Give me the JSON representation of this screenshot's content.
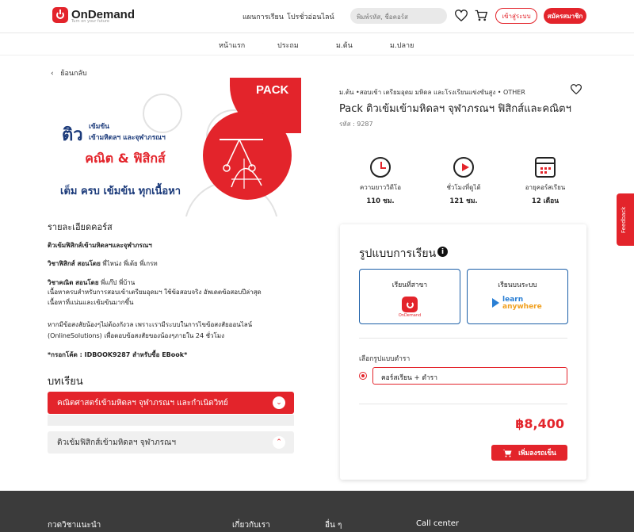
{
  "header": {
    "logo_text": "OnDemand",
    "logo_tagline": "Turn on your future",
    "nav_plan": "แผนการเรียน",
    "nav_promo": "โปรชั่วอ่อนไลน์",
    "search_placeholder": "พิมพ์รหัส, ชื่อคอร์ส",
    "login_label": "เข้าสู่ระบบ",
    "register_label": "สมัครสมาชิก"
  },
  "subnav": {
    "home": "หน้าแรก",
    "primary": "ประถม",
    "lower_secondary": "ม.ต้น",
    "upper_secondary": "ม.ปลาย"
  },
  "back_label": "ย้อนกลับ",
  "pack_image": {
    "label": "PACK",
    "t1": "ติว",
    "t2": "เข้มข้น",
    "t3": "เข้ามหิดลฯ และจุฬาภรณฯ",
    "banner": "คณิต & ฟิสิกส์",
    "t4": "เต็ม ครบ เข้มข้น ทุกเนื้อหา"
  },
  "details": {
    "title": "รายละเอียดคอร์ส",
    "line1": "ติวเข้มฟิสิกส์เข้ามหิดลฯและจุฬาภรณฯ",
    "line2_bold": "วิชาฟิสิกส์ สอนโดย",
    "line2_rest": " พี่ไหน่ง พี่เต้ย พี่เกรท",
    "line3_bold": "วิชาคณิต สอนโดย",
    "line3_rest": " พี่แก๊ป พี่บ้าน",
    "line4": "เนื้อหาครบสำหรับการสอบเข้าเตรียมอุดมฯ ใช้ข้อสอบจริง อัพเดตข้อสอบปีล่าสุด",
    "line5": "เนื้อหาที่แน่นและเข้มข้นมากขึ้น",
    "line6": "หากมีข้อสงสัยน้องๆไม่ต้องกังวล เพราะเรามีระบบในการไขข้อสงสัยออนไลน์",
    "line7": "(OnlineSolutions) เพื่อตอบข้อสงสัยของน้องๆภายใน 24 ชั่วโมง",
    "line8": "*กรอกโค้ด : IDBOOK9287 สำหรับซื้อ EBook*"
  },
  "lessons": {
    "title": "บทเรียน",
    "item1": "คณิตศาสตร์เข้ามหิดลฯ จุฬาภรณฯ และกำเนิดวิทย์",
    "item2": "ติวเข้มฟิสิกส์เข้ามหิดลฯ จุฬาภรณฯ"
  },
  "course": {
    "breadcrumb": "ม.ต้น •สอบเข้า เตรียมอุดม มหิดล และโรงเรียนแข่งขันสูง • OTHER",
    "title": "Pack ติวเข้มเข้ามหิดลฯ จุฬาภรณฯ ฟิสิกส์และคณิตฯ",
    "code": "รหัส : 9287"
  },
  "stats": [
    {
      "label": "ความยาววิดีโอ",
      "value": "110 ชม."
    },
    {
      "label": "ชั่วโมงที่ดูได้",
      "value": "121 ชม."
    },
    {
      "label": "อายุคอร์สเรียน",
      "value": "12 เดือน"
    }
  ],
  "purchase": {
    "title": "รูปแบบการเรียน",
    "opt1_label": "เรียนที่สาขา",
    "opt1_logo": "OnDemand",
    "opt2_label": "เรียนบนระบบ",
    "opt2_logo_line1": "learn",
    "opt2_logo_line2": "anywhere",
    "select_label": "เลือกรูปแบบตำรา",
    "select_value": "คอร์สเรียน + ตำรา",
    "price": "฿8,400",
    "cart_label": "เพิ่มลงรถเข็น"
  },
  "feedback_label": "Feedback",
  "footer": {
    "col1": "กวดวิชาแนะนำ",
    "col2": "เกี่ยวกับเรา",
    "col3": "อื่น ๆ",
    "col4": "Call center"
  },
  "colors": {
    "accent": "#e3242b",
    "navy": "#1b3a7a",
    "blue_border": "#1b5fa8",
    "footer": "#3b3b3b"
  }
}
